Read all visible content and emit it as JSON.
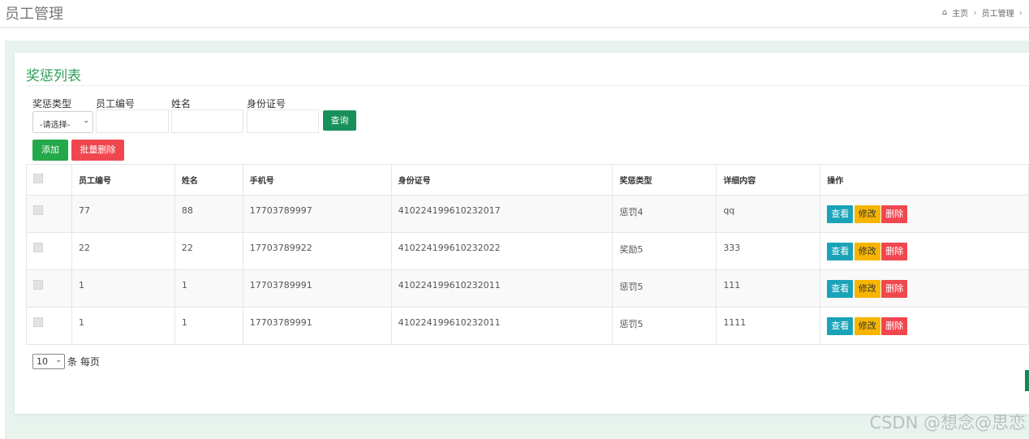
{
  "header": {
    "page_title": "员工管理",
    "breadcrumb": [
      "主页",
      "员工管理"
    ],
    "breadcrumb_sep": "›"
  },
  "card": {
    "title": "奖惩列表"
  },
  "filters": {
    "reward_type_label": "奖惩类型",
    "reward_type_value": "-请选择-",
    "emp_no_label": "员工编号",
    "name_label": "姓名",
    "id_card_label": "身份证号",
    "query_button": "查询"
  },
  "toolbar": {
    "add_button": "添加",
    "batch_delete_button": "批量删除"
  },
  "table": {
    "columns": [
      "员工编号",
      "姓名",
      "手机号",
      "身份证号",
      "奖惩类型",
      "详细内容",
      "操作"
    ],
    "rows": [
      {
        "emp_no": "77",
        "name": "88",
        "phone": "17703789997",
        "id_card": "410224199610232017",
        "type": "惩罚4",
        "detail": "qq"
      },
      {
        "emp_no": "22",
        "name": "22",
        "phone": "17703789922",
        "id_card": "410224199610232022",
        "type": "奖励5",
        "detail": "333"
      },
      {
        "emp_no": "1",
        "name": "1",
        "phone": "17703789991",
        "id_card": "410224199610232011",
        "type": "惩罚5",
        "detail": "111"
      },
      {
        "emp_no": "1",
        "name": "1",
        "phone": "17703789991",
        "id_card": "410224199610232011",
        "type": "惩罚5",
        "detail": "1111"
      }
    ],
    "actions": {
      "view": "查看",
      "edit": "修改",
      "delete": "删除"
    }
  },
  "pager": {
    "page_size": "10",
    "suffix": "条 每页"
  },
  "watermark": "CSDN @想念@思恋",
  "colors": {
    "title_green": "#2e9e55",
    "query_button": "#17905a",
    "add_button": "#23a84a",
    "delete_red": "#f0474f",
    "view_teal": "#1aa3b8",
    "edit_yellow": "#f7b500"
  }
}
